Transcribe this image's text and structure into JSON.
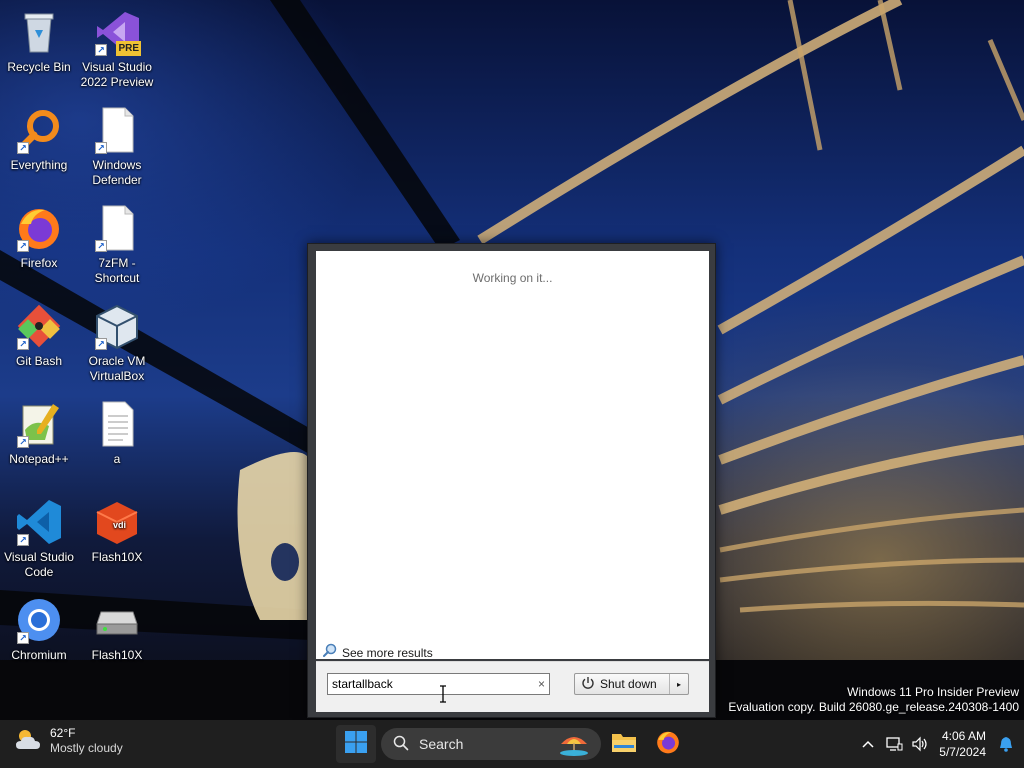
{
  "desktop": {
    "icons": [
      {
        "label": "Recycle Bin",
        "icon": "recycle-bin-icon"
      },
      {
        "label": "Visual Studio 2022 Preview",
        "icon": "visual-studio-icon",
        "badge": "PRE"
      },
      {
        "label": "Everything",
        "icon": "everything-search-icon"
      },
      {
        "label": "Windows Defender",
        "icon": "blank-file-icon"
      },
      {
        "label": "Firefox",
        "icon": "firefox-icon"
      },
      {
        "label": "7zFM - Shortcut",
        "icon": "blank-file-icon"
      },
      {
        "label": "Git Bash",
        "icon": "git-icon"
      },
      {
        "label": "Oracle VM VirtualBox",
        "icon": "virtualbox-icon"
      },
      {
        "label": "Notepad++",
        "icon": "notepad-plus-plus-icon"
      },
      {
        "label": "a",
        "icon": "text-file-icon"
      },
      {
        "label": "Visual Studio Code",
        "icon": "vscode-icon"
      },
      {
        "label": "Flash10X",
        "icon": "vdi-disk-icon",
        "badge": "vdi"
      },
      {
        "label": "Chromium",
        "icon": "chromium-icon"
      },
      {
        "label": "Flash10X",
        "icon": "drive-icon"
      }
    ]
  },
  "start_menu": {
    "status_text": "Working on it...",
    "see_more": "See more results",
    "search_value": "startallback",
    "clear_glyph": "×",
    "shutdown_label": "Shut down",
    "shutdown_arrow": "▸"
  },
  "watermark": {
    "line1": "Windows 11 Pro Insider Preview",
    "line2": "Evaluation copy. Build 26080.ge_release.240308-1400"
  },
  "taskbar": {
    "weather_temp": "62°F",
    "weather_cond": "Mostly cloudy",
    "search_label": "Search",
    "time": "4:06 AM",
    "date": "5/7/2024"
  },
  "colors": {
    "taskbar": "#1f1f1f",
    "start_frame": "#3a3c40",
    "accent": "#0078d4"
  }
}
